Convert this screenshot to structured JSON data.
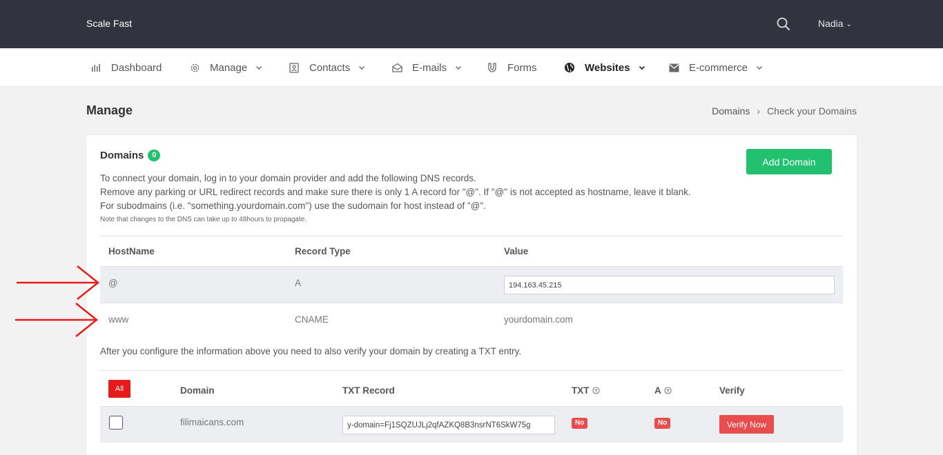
{
  "topbar": {
    "brand": "Scale Fast",
    "search_icon": "search-icon",
    "user_name": "Nadia"
  },
  "nav": {
    "items": [
      {
        "label": "Dashboard",
        "icon": "bar-chart-icon"
      },
      {
        "label": "Manage",
        "icon": "gear-icon"
      },
      {
        "label": "Contacts",
        "icon": "contact-card-icon"
      },
      {
        "label": "E-mails",
        "icon": "envelope-open-icon"
      },
      {
        "label": "Forms",
        "icon": "magnet-icon"
      },
      {
        "label": "Websites",
        "icon": "globe-icon"
      },
      {
        "label": "E-commerce",
        "icon": "mail-icon"
      }
    ]
  },
  "page": {
    "title": "Manage",
    "breadcrumb": [
      "Domains",
      "Check your Domains"
    ]
  },
  "card": {
    "title": "Domains",
    "count": "0",
    "add_button": "Add Domain",
    "intro_lines": [
      "To connect your domain, log in to your domain provider and add the following DNS records.",
      "Remove any parking or URL redirect records and make sure there is only 1 A record for \"@\". If \"@\" is not accepted as hostname, leave it blank.",
      "For subodmains (i.e. \"something.yourdomain.com\") use the sudomain for host instead of \"@\"."
    ],
    "note": "Note that changes to the DNS can take up to 48hours to propagate."
  },
  "dns_table": {
    "headers": [
      "HostName",
      "Record Type",
      "Value"
    ],
    "rows": [
      {
        "host": "@",
        "type": "A",
        "value": "194.163.45.215"
      },
      {
        "host": "www",
        "type": "CNAME",
        "value": "yourdomain.com"
      }
    ]
  },
  "after_text": "After you configure the information above you need to also verify your domain by creating a TXT entry.",
  "txt_table": {
    "all_button": "All",
    "headers": [
      "Domain",
      "TXT Record",
      "TXT",
      "A",
      "Verify"
    ],
    "rows": [
      {
        "domain": "filimaicans.com",
        "txt_record": "y-domain=Fj1SQZUJLj2qfAZKQ8B3nsrNT6SkW75g",
        "txt_status": "No",
        "a_status": "No",
        "verify_label": "Verify Now"
      }
    ]
  },
  "colors": {
    "topbar": "#31343e",
    "green": "#21c170",
    "red": "#e94c4c",
    "arrow": "#e81a1a"
  }
}
